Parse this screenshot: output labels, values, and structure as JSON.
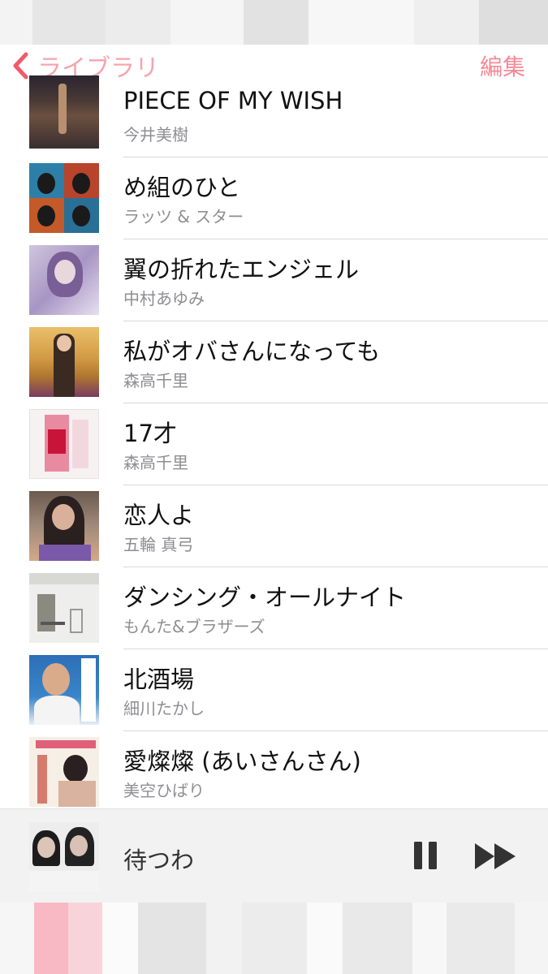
{
  "nav": {
    "back_label": "ライブラリ",
    "edit_label": "編集"
  },
  "accent_color": "#f05a6b",
  "songs": [
    {
      "title": "PIECE OF MY WISH",
      "artist": "今井美樹"
    },
    {
      "title": "め組のひと",
      "artist": "ラッツ & スター"
    },
    {
      "title": "翼の折れたエンジェル",
      "artist": "中村あゆみ"
    },
    {
      "title": "私がオバさんになっても",
      "artist": "森高千里"
    },
    {
      "title": "17才",
      "artist": "森高千里"
    },
    {
      "title": "恋人よ",
      "artist": "五輪 真弓"
    },
    {
      "title": "ダンシング・オールナイト",
      "artist": "もんた&ブラザーズ"
    },
    {
      "title": "北酒場",
      "artist": "細川たかし"
    },
    {
      "title": "愛燦燦 (あいさんさん)",
      "artist": "美空ひばり"
    }
  ],
  "now_playing": {
    "title": "待つわ",
    "pause_icon": "pause-icon",
    "next_icon": "fast-forward-icon"
  }
}
